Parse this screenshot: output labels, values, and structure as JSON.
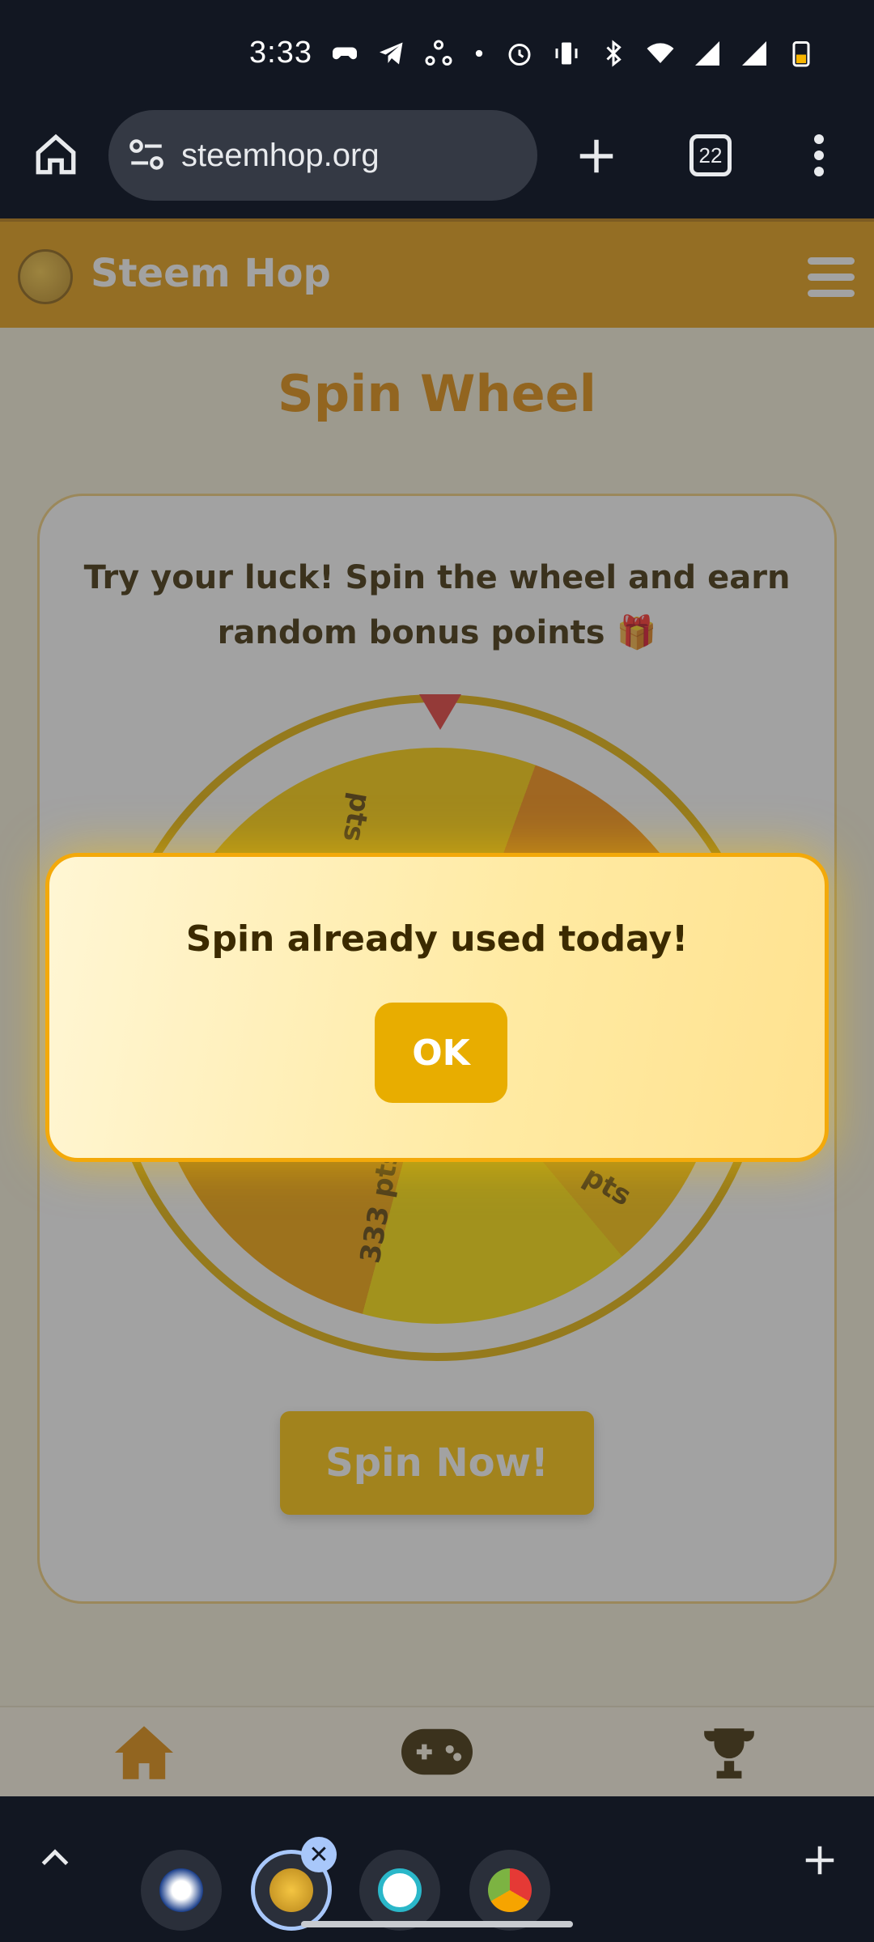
{
  "status_bar": {
    "time": "3:33"
  },
  "browser": {
    "url": "steemhop.org",
    "tab_count": "22"
  },
  "site": {
    "brand": "Steem Hop",
    "logo_text": "STEEM HOP"
  },
  "main": {
    "title": "Spin Wheel",
    "intro": "Try your luck! Spin the wheel and earn random bonus points 🎁",
    "wheel_labels": [
      "pts",
      "333 pts",
      "pts"
    ],
    "spin_button": "Spin Now!"
  },
  "modal": {
    "message": "Spin already used today!",
    "ok_label": "OK"
  },
  "colors": {
    "accent": "#e49b0f",
    "pointer": "#e53935",
    "wheel_ring": "#e6b300"
  }
}
